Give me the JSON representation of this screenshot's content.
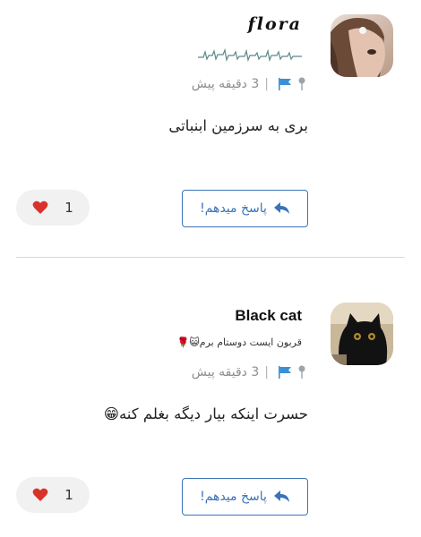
{
  "comments": [
    {
      "username": "flora",
      "tagline": "",
      "timestamp": "3 دقیقه پیش",
      "separator": "|",
      "text": "بری به سرزمین ابنباتی",
      "reply_label": "پاسخ میدهم!",
      "like_count": "1"
    },
    {
      "username": "Black cat",
      "tagline": "قربون ایست دوستام برم😺🌹",
      "timestamp": "3 دقیقه پیش",
      "separator": "|",
      "text": "حسرت اینکه بیار دیگه بغلم کنه😁",
      "reply_label": "پاسخ میدهم!",
      "like_count": "1"
    }
  ],
  "colors": {
    "accent": "#3a73b8",
    "flag": "#3b8fd4",
    "meta_text": "#8d8d8d",
    "like_bg": "#f1f1f1",
    "heart": "#d9322b"
  },
  "icons": {
    "pin": "pin-icon",
    "flag": "flag-icon",
    "reply": "reply-arrow-icon",
    "like": "heart-icon"
  }
}
